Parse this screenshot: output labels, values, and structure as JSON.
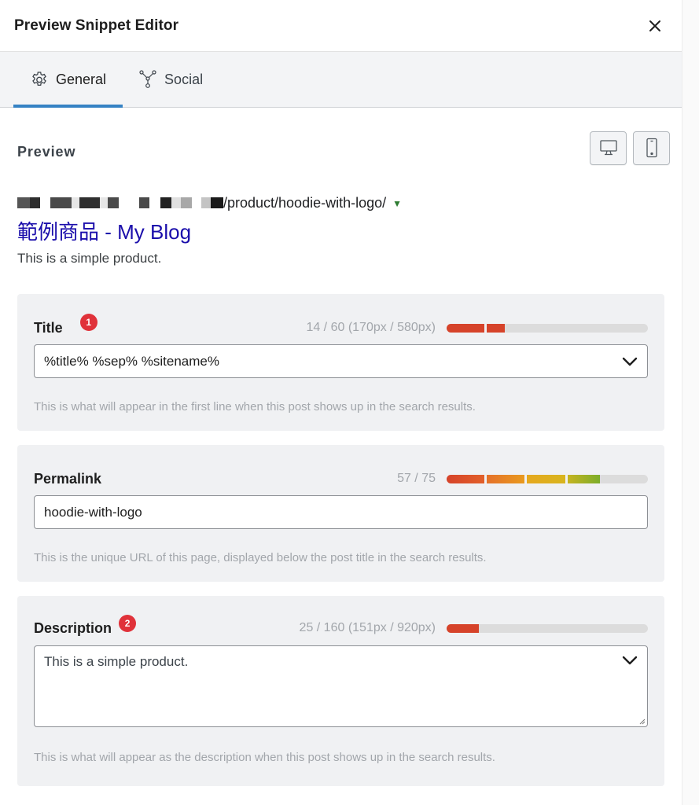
{
  "header": {
    "title": "Preview Snippet Editor",
    "close_icon": "close-icon"
  },
  "tabs": [
    {
      "label": "General",
      "icon": "gear-icon",
      "active": true
    },
    {
      "label": "Social",
      "icon": "share-nodes-icon",
      "active": false
    }
  ],
  "preview": {
    "label": "Preview",
    "device_buttons": [
      {
        "name": "desktop",
        "icon": "desktop-icon"
      },
      {
        "name": "mobile",
        "icon": "mobile-icon"
      }
    ],
    "serp": {
      "url_path": "/product/hoodie-with-logo/",
      "title": "範例商品 - My Blog",
      "description": "This is a simple product."
    }
  },
  "fields": {
    "title": {
      "label": "Title",
      "badge": "1",
      "counter": "14 / 60 (170px / 580px)",
      "progress_percent": 29,
      "value": "%title% %sep% %sitename%",
      "help": "This is what will appear in the first line when this post shows up in the search results."
    },
    "permalink": {
      "label": "Permalink",
      "counter": "57 / 75",
      "progress_percent": 76,
      "value": "hoodie-with-logo",
      "help": "This is the unique URL of this page, displayed below the post title in the search results."
    },
    "description": {
      "label": "Description",
      "badge": "2",
      "counter": "25 / 160 (151px / 920px)",
      "progress_percent": 16,
      "value": "This is a simple product.",
      "help": "This is what will appear as the description when this post shows up in the search results."
    }
  },
  "colors": {
    "accent": "#3582c4",
    "serp_title": "#1a0dab",
    "badge": "#e0323a",
    "bar_red": "#d6432a",
    "bar_orange": "#e67e22",
    "bar_yellow": "#ddb31e",
    "bar_green": "#7cad2a",
    "bar_track": "#dcdcdc"
  }
}
